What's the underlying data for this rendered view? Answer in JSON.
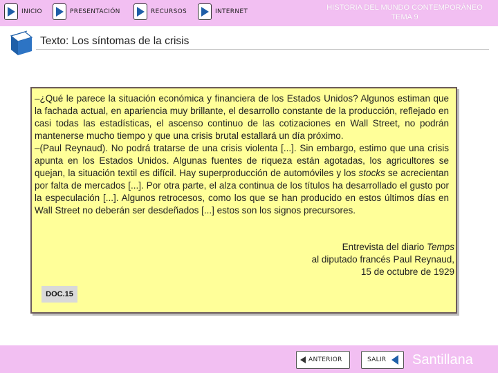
{
  "header": {
    "nav": [
      {
        "label": "INICIO"
      },
      {
        "label": "PRESENTACIÓN"
      },
      {
        "label": "RECURSOS"
      },
      {
        "label": "INTERNET"
      }
    ],
    "title_line1": "HISTORIA DEL MUNDO CONTEMPORÁNEO",
    "title_line2": "TEMA 9"
  },
  "page": {
    "subtitle": "Texto: Los síntomas de la crisis"
  },
  "document": {
    "paragraph1": "–¿Qué le parece la situación económica y financiera de los Estados Unidos? Algunos estiman que la fachada actual, en apariencia muy brillante, el desarrollo constante de la producción, reflejado en casi todas las estadísticas, el ascenso continuo de las cotizaciones en Wall Street, no podrán mantenerse mucho tiempo y que una crisis brutal estallará un día próximo.",
    "paragraph2_before": "–(Paul Reynaud). No podrá tratarse de una crisis violenta [...]. Sin embargo, estimo que una crisis apunta en los Estados Unidos. Algunas fuentes de riqueza están agotadas, los agricultores se quejan, la situación textil es difícil. Hay superproducción de automóviles y los ",
    "paragraph2_italic": "stocks",
    "paragraph2_after": " se acrecientan por falta de mercados [...]. Por otra parte, el alza continua de los títulos ha desarrollado el gusto por la especulación [...]. Algunos retrocesos, como los que se han producido en estos últimos días en Wall Street no deberán ser desdeñados [...] estos son los signos precursores.",
    "source_line1_before": "Entrevista del diario ",
    "source_line1_italic": "Temps",
    "source_line2": "al diputado francés Paul Reynaud,",
    "source_line3": "15 de octubre de 1929",
    "badge": "DOC.15"
  },
  "footer": {
    "prev_label": "ANTERIOR",
    "exit_label": "SALIR",
    "brand": "Santillana"
  },
  "colors": {
    "bar": "#f2bff2",
    "doc_background": "#ffff99",
    "icon_blue": "#1f5fa8"
  }
}
